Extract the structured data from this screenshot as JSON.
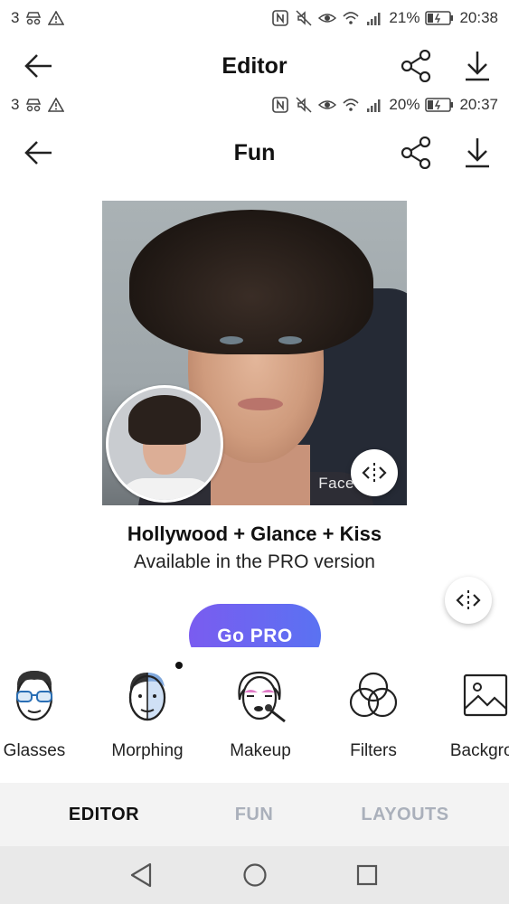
{
  "status_bar_top": {
    "left_text": "3",
    "battery_percent": "21%",
    "time": "20:38",
    "icons": [
      "incognito-icon",
      "warning-icon",
      "nfc-icon",
      "mute-icon",
      "eye-icon",
      "wifi-icon",
      "signal-icon",
      "battery-icon"
    ]
  },
  "header_top": {
    "title": "Editor"
  },
  "status_bar_second": {
    "left_text": "3",
    "battery_percent": "20%",
    "time": "20:37"
  },
  "header": {
    "title": "Fun"
  },
  "preview": {
    "watermark": "Face"
  },
  "effect": {
    "name": "Hollywood + Glance + Kiss",
    "availability": "Available in the PRO version"
  },
  "go_pro": {
    "label": "Go PRO"
  },
  "tools": [
    {
      "label": "Glasses",
      "icon": "glasses-face-icon"
    },
    {
      "label": "Morphing",
      "icon": "morphing-face-icon"
    },
    {
      "label": "Makeup",
      "icon": "makeup-face-icon"
    },
    {
      "label": "Filters",
      "icon": "filters-icon"
    },
    {
      "label": "Backgrou",
      "icon": "background-image-icon"
    }
  ],
  "tabs": [
    {
      "label": "EDITOR",
      "active": true
    },
    {
      "label": "FUN",
      "active": false
    },
    {
      "label": "LAYOUTS",
      "active": false
    }
  ],
  "colors": {
    "accent_start": "#7a5cf0",
    "accent_end": "#5a72f2",
    "tab_inactive": "#aab0bb",
    "tab_bar_bg": "#f3f3f3",
    "nav_bar_bg": "#e9e9e9"
  }
}
